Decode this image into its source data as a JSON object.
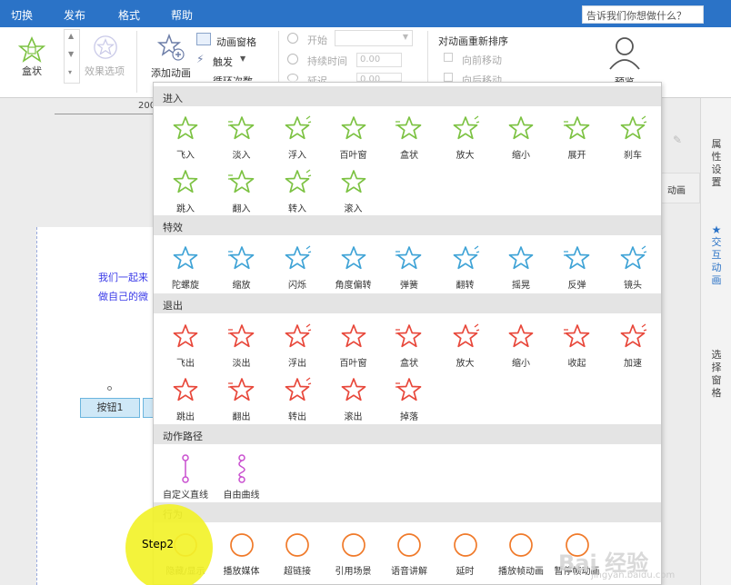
{
  "menu": [
    "切换",
    "发布",
    "格式",
    "帮助"
  ],
  "tellme": "告诉我们你想做什么？",
  "ribbon": {
    "box_label": "盒状",
    "effect_options": "效果选项",
    "add_animation": "添加动画",
    "anim_pane": "动画窗格",
    "trigger": "触发",
    "loop": "循环次数",
    "start": "开始",
    "duration": "持续时间",
    "duration_val": "0.00",
    "delay": "延迟",
    "delay_val": "0.00",
    "reorder": "对动画重新排序",
    "move_earlier": "向前移动",
    "move_later": "向后移动",
    "preview": "预览"
  },
  "ruler_label": "200",
  "slide": {
    "line1": "我们一起来",
    "line2": "做自己的微",
    "button": "按钮1"
  },
  "right_tabs": [
    "属性设置",
    "交互动画",
    "选择窗格"
  ],
  "behind_label": "动画",
  "sections": {
    "enter": "进入",
    "emphasis": "特效",
    "exit": "退出",
    "path": "动作路径",
    "action": "行为"
  },
  "enter_items": [
    "飞入",
    "淡入",
    "浮入",
    "百叶窗",
    "盒状",
    "放大",
    "缩小",
    "展开",
    "刹车",
    "跳入",
    "翻入",
    "转入",
    "滚入"
  ],
  "emphasis_items": [
    "陀螺旋",
    "缩放",
    "闪烁",
    "角度偏转",
    "弹簧",
    "翻转",
    "摇晃",
    "反弹",
    "镜头"
  ],
  "exit_items": [
    "飞出",
    "淡出",
    "浮出",
    "百叶窗",
    "盒状",
    "放大",
    "缩小",
    "收起",
    "加速",
    "跳出",
    "翻出",
    "转出",
    "滚出",
    "掉落"
  ],
  "path_items": [
    "自定义直线",
    "自由曲线"
  ],
  "action_items": [
    "隐藏/显示",
    "播放媒体",
    "超链接",
    "引用场景",
    "语音讲解",
    "延时",
    "播放帧动画",
    "暂停帧动画"
  ],
  "step": "Step2",
  "watermark": "Bai 经验",
  "watermark_url": "jingyan.baidu.com",
  "colors": {
    "menubar": "#2b73c7",
    "enter": "#7cc242",
    "emphasis": "#3fa3d6",
    "exit": "#e8473a",
    "path": "#c94fcf",
    "action": "#f07a2a"
  }
}
